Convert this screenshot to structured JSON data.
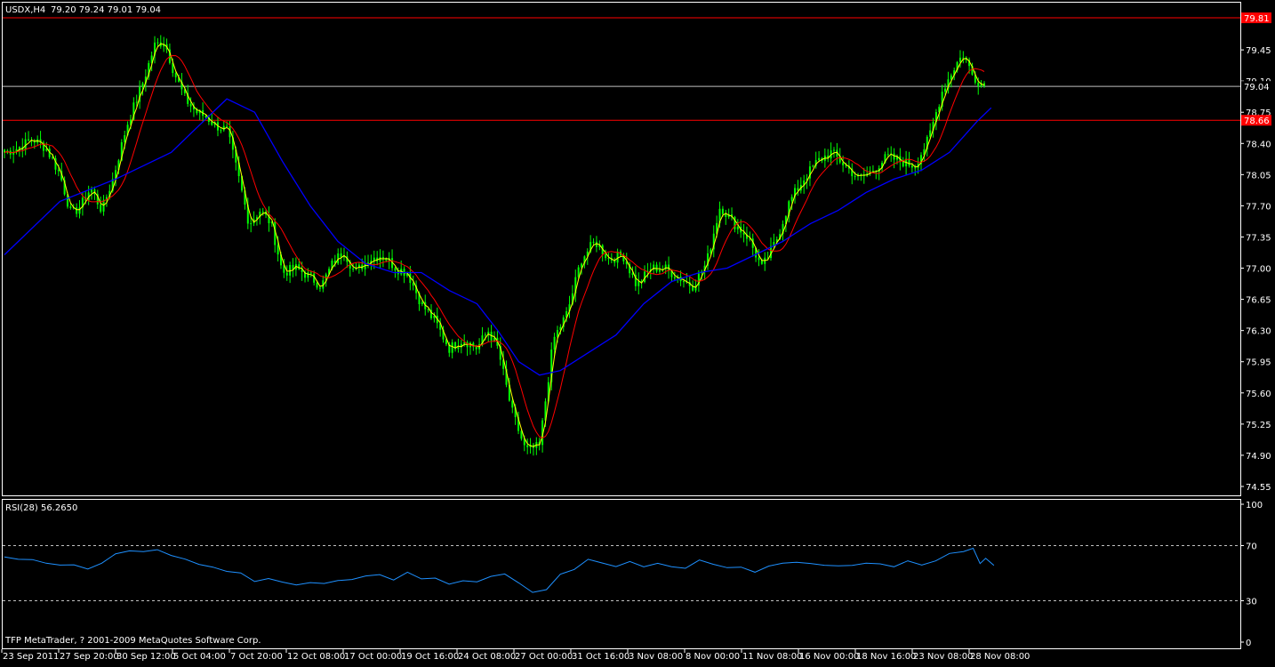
{
  "header": {
    "symbol_tf": "USDX,H4",
    "ohlc": "79.20 79.24 79.01 79.04"
  },
  "footer": {
    "copyright": "TFP MetaTrader, ? 2001-2009 MetaQuotes Software Corp."
  },
  "colors": {
    "background": "#000000",
    "frame": "#ffffff",
    "candle": "#00ff00",
    "ma_fast": "#ffff00",
    "ma_mid": "#ff0000",
    "ma_slow": "#0000ff",
    "hline": "#ff0000",
    "bid_line": "#c0c0c0",
    "rsi_line": "#1e90ff",
    "rsi_level": "#c0c0c0"
  },
  "chart_data": [
    {
      "type": "candlestick",
      "title": "USDX,H4",
      "ylim": [
        74.45,
        79.98
      ],
      "y_ticks": [
        "79.45",
        "79.10",
        "78.75",
        "78.40",
        "78.05",
        "77.70",
        "77.35",
        "77.00",
        "76.65",
        "76.30",
        "75.95",
        "75.60",
        "75.25",
        "74.90",
        "74.55"
      ],
      "x_tick_labels": [
        "23 Sep 2011",
        "27 Sep 20:00",
        "30 Sep 12:00",
        "5 Oct 04:00",
        "7 Oct 20:00",
        "12 Oct 08:00",
        "17 Oct 00:00",
        "19 Oct 16:00",
        "24 Oct 08:00",
        "27 Oct 00:00",
        "31 Oct 16:00",
        "3 Nov 08:00",
        "8 Nov 00:00",
        "11 Nov 08:00",
        "16 Nov 00:00",
        "18 Nov 16:00",
        "23 Nov 08:00",
        "28 Nov 08:00"
      ],
      "bar_count": 327,
      "close_path": [
        [
          0,
          78.3
        ],
        [
          10,
          78.35
        ],
        [
          20,
          78.45
        ],
        [
          30,
          78.35
        ],
        [
          40,
          78.05
        ],
        [
          48,
          77.6
        ],
        [
          55,
          77.7
        ],
        [
          62,
          77.9
        ],
        [
          70,
          77.65
        ],
        [
          78,
          78.0
        ],
        [
          88,
          78.6
        ],
        [
          100,
          79.1
        ],
        [
          108,
          79.5
        ],
        [
          115,
          79.55
        ],
        [
          122,
          79.2
        ],
        [
          130,
          78.9
        ],
        [
          138,
          78.75
        ],
        [
          145,
          78.7
        ],
        [
          152,
          78.6
        ],
        [
          160,
          78.55
        ],
        [
          168,
          78.05
        ],
        [
          176,
          77.5
        ],
        [
          184,
          77.65
        ],
        [
          192,
          77.5
        ],
        [
          200,
          76.95
        ],
        [
          210,
          77.0
        ],
        [
          220,
          76.9
        ],
        [
          228,
          76.8
        ],
        [
          236,
          77.05
        ],
        [
          244,
          77.2
        ],
        [
          252,
          76.95
        ],
        [
          262,
          77.1
        ],
        [
          272,
          77.15
        ],
        [
          282,
          77.0
        ],
        [
          290,
          76.95
        ],
        [
          300,
          76.6
        ],
        [
          310,
          76.4
        ],
        [
          320,
          76.1
        ],
        [
          330,
          76.2
        ],
        [
          340,
          76.1
        ],
        [
          348,
          76.3
        ],
        [
          355,
          76.1
        ],
        [
          365,
          75.4
        ],
        [
          375,
          74.95
        ],
        [
          385,
          75.0
        ],
        [
          395,
          76.2
        ],
        [
          405,
          76.5
        ],
        [
          415,
          77.1
        ],
        [
          425,
          77.3
        ],
        [
          435,
          77.1
        ],
        [
          445,
          77.15
        ],
        [
          455,
          76.8
        ],
        [
          465,
          77.0
        ],
        [
          475,
          77.0
        ],
        [
          485,
          76.9
        ],
        [
          495,
          76.8
        ],
        [
          505,
          77.05
        ],
        [
          515,
          77.7
        ],
        [
          525,
          77.5
        ],
        [
          535,
          77.35
        ],
        [
          545,
          77.0
        ],
        [
          555,
          77.3
        ],
        [
          565,
          77.75
        ],
        [
          575,
          78.0
        ],
        [
          585,
          78.2
        ],
        [
          595,
          78.3
        ],
        [
          605,
          78.15
        ],
        [
          615,
          78.0
        ],
        [
          625,
          78.1
        ],
        [
          635,
          78.25
        ],
        [
          645,
          78.2
        ],
        [
          655,
          78.15
        ],
        [
          665,
          78.45
        ],
        [
          675,
          79.0
        ],
        [
          685,
          79.3
        ],
        [
          690,
          79.4
        ],
        [
          697,
          79.15
        ],
        [
          705,
          79.05
        ]
      ],
      "series": [
        {
          "name": "Close"
        },
        {
          "name": "",
          "role": "fast MA"
        },
        {
          "name": "",
          "role": "mid MA"
        },
        {
          "name": "",
          "role": "slow MA",
          "path": [
            [
              0,
              77.15
            ],
            [
              40,
              77.75
            ],
            [
              80,
              78.0
            ],
            [
              120,
              78.3
            ],
            [
              140,
              78.6
            ],
            [
              160,
              78.9
            ],
            [
              180,
              78.75
            ],
            [
              200,
              78.2
            ],
            [
              220,
              77.7
            ],
            [
              240,
              77.3
            ],
            [
              260,
              77.05
            ],
            [
              280,
              76.95
            ],
            [
              300,
              76.95
            ],
            [
              320,
              76.75
            ],
            [
              340,
              76.6
            ],
            [
              355,
              76.3
            ],
            [
              370,
              75.95
            ],
            [
              385,
              75.8
            ],
            [
              400,
              75.85
            ],
            [
              420,
              76.05
            ],
            [
              440,
              76.25
            ],
            [
              460,
              76.6
            ],
            [
              480,
              76.85
            ],
            [
              500,
              76.95
            ],
            [
              520,
              77.0
            ],
            [
              540,
              77.15
            ],
            [
              560,
              77.3
            ],
            [
              580,
              77.5
            ],
            [
              600,
              77.65
            ],
            [
              620,
              77.85
            ],
            [
              640,
              78.0
            ],
            [
              660,
              78.1
            ],
            [
              680,
              78.3
            ],
            [
              700,
              78.65
            ],
            [
              710,
              78.8
            ]
          ]
        }
      ],
      "hlines": [
        {
          "label": "79.81",
          "value": 79.81
        },
        {
          "label": "78.66",
          "value": 78.66
        }
      ],
      "bid": {
        "label": "79.04",
        "value": 79.04
      }
    },
    {
      "type": "line",
      "title": "RSI(28) 56.2650",
      "ylim": [
        0,
        100
      ],
      "y_ticks": [
        "100",
        "70",
        "30",
        "0"
      ],
      "levels": [
        70,
        30
      ],
      "series": [
        {
          "name": "RSI(28)",
          "values": [
            [
              0,
              62.5
            ],
            [
              10,
              60.5
            ],
            [
              20,
              61.0
            ],
            [
              30,
              58.0
            ],
            [
              40,
              55.0
            ],
            [
              50,
              56.0
            ],
            [
              60,
              53.0
            ],
            [
              70,
              58.0
            ],
            [
              80,
              63.0
            ],
            [
              90,
              66.0
            ],
            [
              100,
              65.0
            ],
            [
              110,
              66.5
            ],
            [
              120,
              62.0
            ],
            [
              130,
              59.0
            ],
            [
              140,
              57.0
            ],
            [
              150,
              54.0
            ],
            [
              160,
              52.0
            ],
            [
              170,
              49.0
            ],
            [
              180,
              44.0
            ],
            [
              190,
              45.0
            ],
            [
              200,
              44.0
            ],
            [
              210,
              41.0
            ],
            [
              220,
              43.0
            ],
            [
              230,
              42.0
            ],
            [
              240,
              44.0
            ],
            [
              250,
              45.5
            ],
            [
              260,
              48.0
            ],
            [
              270,
              50.0
            ],
            [
              280,
              46.0
            ],
            [
              290,
              51.5
            ],
            [
              300,
              47.0
            ],
            [
              310,
              45.5
            ],
            [
              320,
              43.0
            ],
            [
              330,
              45.5
            ],
            [
              340,
              44.5
            ],
            [
              350,
              47.0
            ],
            [
              360,
              49.0
            ],
            [
              370,
              43.0
            ],
            [
              380,
              36.0
            ],
            [
              390,
              39.0
            ],
            [
              400,
              50.0
            ],
            [
              410,
              52.0
            ],
            [
              420,
              59.0
            ],
            [
              430,
              57.0
            ],
            [
              440,
              56.0
            ],
            [
              450,
              58.5
            ],
            [
              460,
              55.0
            ],
            [
              470,
              57.0
            ],
            [
              480,
              55.5
            ],
            [
              490,
              53.0
            ],
            [
              500,
              58.5
            ],
            [
              510,
              56.5
            ],
            [
              520,
              55.0
            ],
            [
              530,
              54.5
            ],
            [
              540,
              50.0
            ],
            [
              550,
              54.0
            ],
            [
              560,
              57.0
            ],
            [
              570,
              58.0
            ],
            [
              580,
              56.5
            ],
            [
              590,
              55.0
            ],
            [
              600,
              56.5
            ],
            [
              610,
              55.0
            ],
            [
              620,
              57.5
            ],
            [
              630,
              56.0
            ],
            [
              640,
              54.5
            ],
            [
              650,
              58.0
            ],
            [
              660,
              56.5
            ],
            [
              670,
              59.0
            ],
            [
              680,
              64.0
            ],
            [
              690,
              65.0
            ],
            [
              697,
              67.0
            ],
            [
              702,
              58.0
            ],
            [
              706,
              60.0
            ],
            [
              712,
              56.0
            ]
          ]
        }
      ]
    }
  ]
}
